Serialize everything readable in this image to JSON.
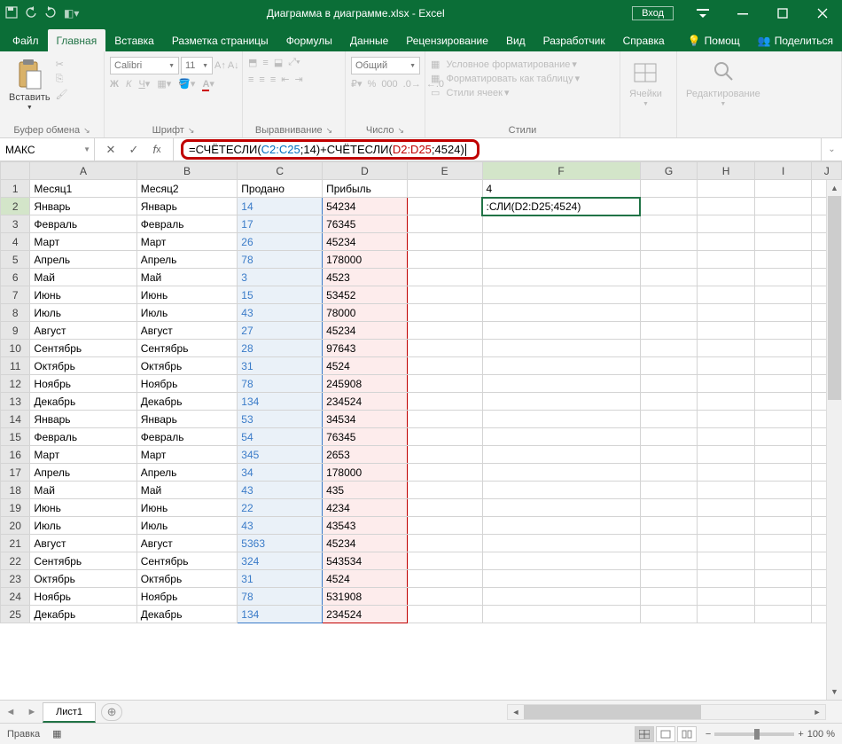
{
  "title": "Диаграмма в диаграмме.xlsx - Excel",
  "login": "Вход",
  "tabs": {
    "file": "Файл",
    "home": "Главная",
    "insert": "Вставка",
    "layout": "Разметка страницы",
    "formulas": "Формулы",
    "data": "Данные",
    "review": "Рецензирование",
    "view": "Вид",
    "developer": "Разработчик",
    "help": "Справка",
    "tellme": "Помощ",
    "share": "Поделиться"
  },
  "ribbon": {
    "paste": "Вставить",
    "clipboard": "Буфер обмена",
    "font_name": "Calibri",
    "font_size": "11",
    "font": "Шрифт",
    "alignment": "Выравнивание",
    "number_format": "Общий",
    "number": "Число",
    "cond_fmt": "Условное форматирование",
    "as_table": "Форматировать как таблицу",
    "cell_styles": "Стили ячеек",
    "styles": "Стили",
    "cells": "Ячейки",
    "editing": "Редактирование"
  },
  "namecell": "МАКС",
  "formula": {
    "pre": "=СЧЁТЕСЛИ(",
    "r1": "C2:C25",
    "mid1": ";14)+СЧЁТЕСЛИ(",
    "r2": "D2:D25",
    "post": ";4524)"
  },
  "columns": [
    "A",
    "B",
    "C",
    "D",
    "E",
    "F",
    "G",
    "H",
    "I",
    "J"
  ],
  "headers": {
    "a": "Месяц1",
    "b": "Месяц2",
    "c": "Продано",
    "d": "Прибыль"
  },
  "f1_value": "4",
  "f2_value": ":СЛИ(D2:D25;4524)",
  "rows": [
    {
      "n": 1
    },
    {
      "n": 2,
      "a": "Январь",
      "b": "Январь",
      "c": "14",
      "d": "54234"
    },
    {
      "n": 3,
      "a": "Февраль",
      "b": "Февраль",
      "c": "17",
      "d": "76345"
    },
    {
      "n": 4,
      "a": "Март",
      "b": "Март",
      "c": "26",
      "d": "45234"
    },
    {
      "n": 5,
      "a": "Апрель",
      "b": "Апрель",
      "c": "78",
      "d": "178000"
    },
    {
      "n": 6,
      "a": "Май",
      "b": "Май",
      "c": "3",
      "d": "4523"
    },
    {
      "n": 7,
      "a": "Июнь",
      "b": "Июнь",
      "c": "15",
      "d": "53452"
    },
    {
      "n": 8,
      "a": "Июль",
      "b": "Июль",
      "c": "43",
      "d": "78000"
    },
    {
      "n": 9,
      "a": "Август",
      "b": "Август",
      "c": "27",
      "d": "45234"
    },
    {
      "n": 10,
      "a": "Сентябрь",
      "b": "Сентябрь",
      "c": "28",
      "d": "97643"
    },
    {
      "n": 11,
      "a": "Октябрь",
      "b": "Октябрь",
      "c": "31",
      "d": "4524"
    },
    {
      "n": 12,
      "a": "Ноябрь",
      "b": "Ноябрь",
      "c": "78",
      "d": "245908"
    },
    {
      "n": 13,
      "a": "Декабрь",
      "b": "Декабрь",
      "c": "134",
      "d": "234524"
    },
    {
      "n": 14,
      "a": "Январь",
      "b": "Январь",
      "c": "53",
      "d": "34534"
    },
    {
      "n": 15,
      "a": "Февраль",
      "b": "Февраль",
      "c": "54",
      "d": "76345"
    },
    {
      "n": 16,
      "a": "Март",
      "b": "Март",
      "c": "345",
      "d": "2653"
    },
    {
      "n": 17,
      "a": "Апрель",
      "b": "Апрель",
      "c": "34",
      "d": "178000"
    },
    {
      "n": 18,
      "a": "Май",
      "b": "Май",
      "c": "43",
      "d": "435"
    },
    {
      "n": 19,
      "a": "Июнь",
      "b": "Июнь",
      "c": "22",
      "d": "4234"
    },
    {
      "n": 20,
      "a": "Июль",
      "b": "Июль",
      "c": "43",
      "d": "43543"
    },
    {
      "n": 21,
      "a": "Август",
      "b": "Август",
      "c": "5363",
      "d": "45234"
    },
    {
      "n": 22,
      "a": "Сентябрь",
      "b": "Сентябрь",
      "c": "324",
      "d": "543534"
    },
    {
      "n": 23,
      "a": "Октябрь",
      "b": "Октябрь",
      "c": "31",
      "d": "4524"
    },
    {
      "n": 24,
      "a": "Ноябрь",
      "b": "Ноябрь",
      "c": "78",
      "d": "531908"
    },
    {
      "n": 25,
      "a": "Декабрь",
      "b": "Декабрь",
      "c": "134",
      "d": "234524"
    }
  ],
  "sheet_tab": "Лист1",
  "status": "Правка",
  "zoom": "100 %"
}
